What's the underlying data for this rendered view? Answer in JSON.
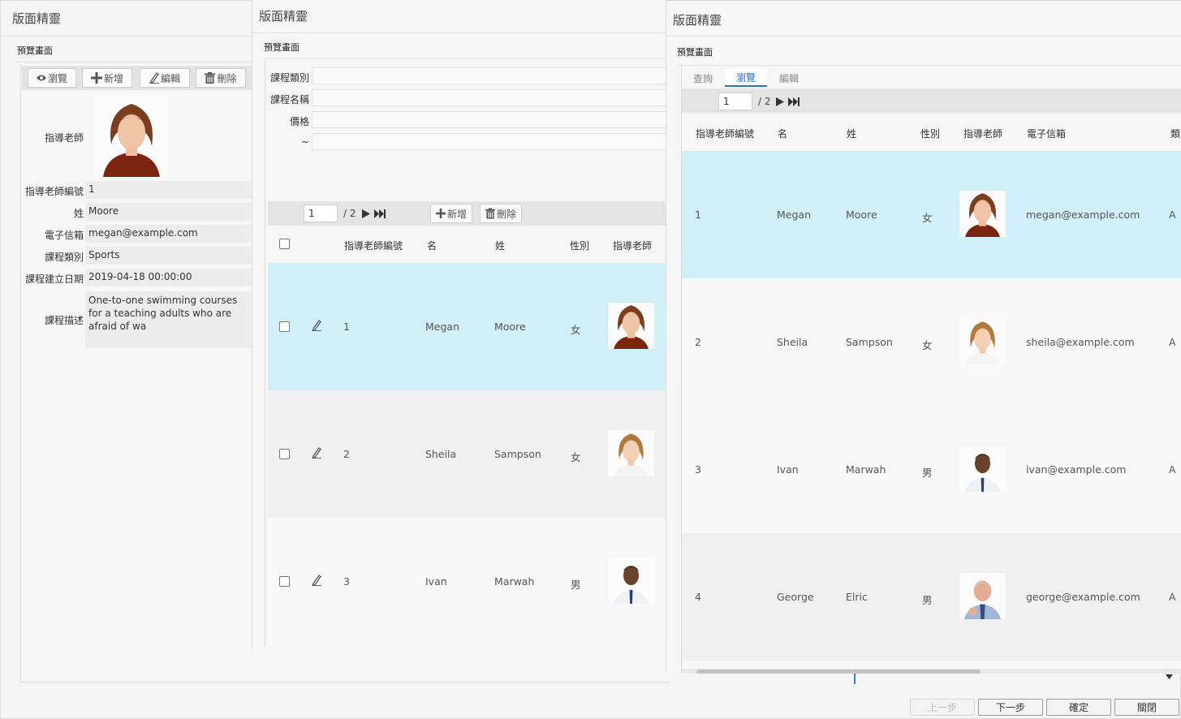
{
  "window1": {
    "title": "版面精靈",
    "subtitle": "預覽畫面",
    "toolbar": {
      "browse": "瀏覽",
      "add": "新增",
      "edit": "編輯",
      "delete": "刪除"
    },
    "form": {
      "teacher_label": "指導老師",
      "teacher_id_label": "指導老師編號",
      "teacher_id": "1",
      "last_name_label": "姓",
      "last_name": "Moore",
      "email_label": "電子信箱",
      "email": "megan@example.com",
      "category_label": "課程類別",
      "category": "Sports",
      "created_label": "課程建立日期",
      "created": "2019-04-18 00:00:00",
      "desc_label": "課程描述",
      "desc": "One-to-one swimming courses for a teaching adults who are afraid of wa"
    }
  },
  "window2": {
    "title": "版面精靈",
    "subtitle": "預覽畫面",
    "query": {
      "category_label": "課程類別",
      "name_label": "課程名稱",
      "price_label": "價格",
      "range_label": "~"
    },
    "pager": {
      "page": "1",
      "total": "/ 2",
      "add": "新增",
      "delete": "刪除"
    },
    "columns": {
      "teacher_id": "指導老師編號",
      "first_name": "名",
      "last_name": "姓",
      "gender": "性別",
      "teacher": "指導老師"
    },
    "rows": [
      {
        "id": "1",
        "first": "Megan",
        "last": "Moore",
        "gender": "女"
      },
      {
        "id": "2",
        "first": "Sheila",
        "last": "Sampson",
        "gender": "女"
      },
      {
        "id": "3",
        "first": "Ivan",
        "last": "Marwah",
        "gender": "男"
      }
    ]
  },
  "window3": {
    "title": "版面精靈",
    "subtitle": "預覽畫面",
    "tabs": {
      "query": "查詢",
      "browse": "瀏覽",
      "edit": "編輯"
    },
    "pager": {
      "page": "1",
      "total": "/ 2"
    },
    "columns": {
      "teacher_id": "指導老師編號",
      "first_name": "名",
      "last_name": "姓",
      "gender": "性別",
      "teacher": "指導老師",
      "email": "電子信箱",
      "category": "類"
    },
    "rows": [
      {
        "id": "1",
        "first": "Megan",
        "last": "Moore",
        "gender": "女",
        "email": "megan@example.com",
        "cat": "A"
      },
      {
        "id": "2",
        "first": "Sheila",
        "last": "Sampson",
        "gender": "女",
        "email": "sheila@example.com",
        "cat": "A"
      },
      {
        "id": "3",
        "first": "Ivan",
        "last": "Marwah",
        "gender": "男",
        "email": "ivan@example.com",
        "cat": "A"
      },
      {
        "id": "4",
        "first": "George",
        "last": "Elric",
        "gender": "男",
        "email": "george@example.com",
        "cat": "A"
      }
    ]
  },
  "footer": {
    "prev": "上一步",
    "next": "下一步",
    "ok": "確定",
    "close": "關閉"
  },
  "colors": {
    "selected_row": "#d0eff7",
    "active_tab": "#2a6fc9"
  }
}
